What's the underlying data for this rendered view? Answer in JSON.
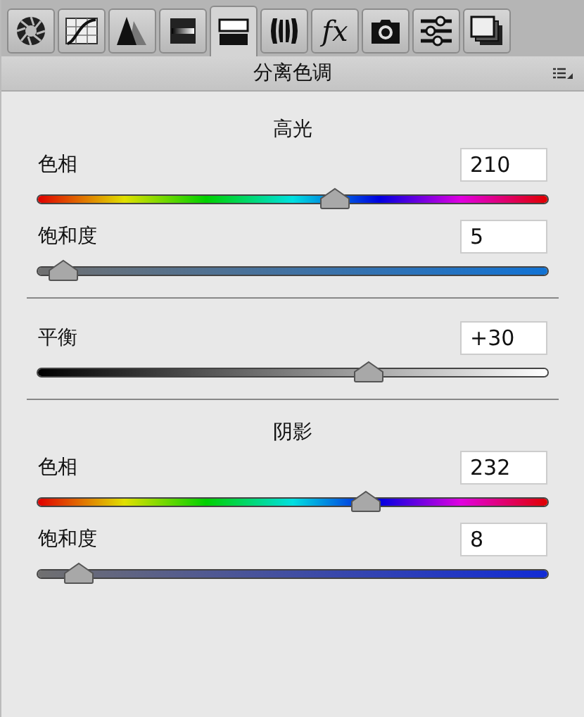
{
  "tabs": [
    {
      "kind": "aperture",
      "selected": false
    },
    {
      "kind": "curve",
      "selected": false
    },
    {
      "kind": "triangles",
      "selected": false
    },
    {
      "kind": "gradient",
      "selected": false
    },
    {
      "kind": "split",
      "selected": true
    },
    {
      "kind": "lens",
      "selected": false
    },
    {
      "kind": "text",
      "label": "fx",
      "selected": false
    },
    {
      "kind": "camera",
      "selected": false
    },
    {
      "kind": "sliders",
      "selected": false
    },
    {
      "kind": "stack",
      "selected": false
    }
  ],
  "panel": {
    "title": "分离色调"
  },
  "sections": [
    {
      "title": "高光",
      "sliders": [
        {
          "kind": "hue",
          "label": "色相",
          "value": "210",
          "level": 0.583
        },
        {
          "kind": "saturation",
          "label": "饱和度",
          "value": "5",
          "level": 0.05
        }
      ]
    },
    {
      "sliders": [
        {
          "kind": "balance",
          "label": "平衡",
          "value": "+30",
          "level": 0.65
        }
      ]
    },
    {
      "title": "阴影",
      "sliders": [
        {
          "kind": "hue",
          "label": "色相",
          "value": "232",
          "level": 0.644
        },
        {
          "kind": "saturation",
          "label": "饱和度",
          "value": "8",
          "level": 0.08
        }
      ]
    }
  ]
}
